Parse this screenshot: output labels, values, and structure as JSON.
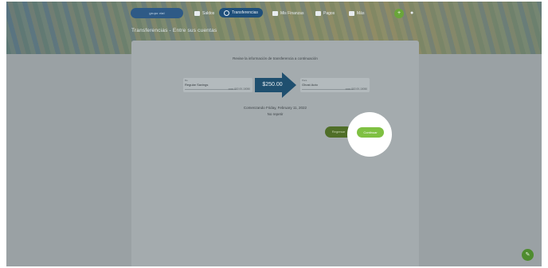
{
  "nav": {
    "logo_text": "grupo vial",
    "items": [
      {
        "label": "Saldos",
        "icon": "wallet-icon"
      },
      {
        "label": "Transferencias",
        "icon": "transfer-icon"
      },
      {
        "label": "Mis Finanzas",
        "icon": "chart-icon"
      },
      {
        "label": "Pagos",
        "icon": "card-icon"
      },
      {
        "label": "Más",
        "icon": "grid-icon"
      }
    ],
    "avatar_initial": "+"
  },
  "page_title": "Transferencias - Entre sus cuentas",
  "card": {
    "heading": "Revise la información de transferencia a continuación",
    "from": {
      "label": "De",
      "name": "Regular Savings",
      "number": "•••••• 002-00-10050"
    },
    "to": {
      "label": "Para",
      "name": "Ghost Auto",
      "number": "•••••• 002-00-10050"
    },
    "amount": "$250.00",
    "date_text": "Comenzando Friday, February 11, 2022",
    "frequency": "No repetir",
    "back_label": "Regresar",
    "continue_label": "Continuar"
  },
  "colors": {
    "accent_green": "#7fc042",
    "nav_active": "#1f4f7a",
    "arrow_blue": "#1f4f6f"
  }
}
